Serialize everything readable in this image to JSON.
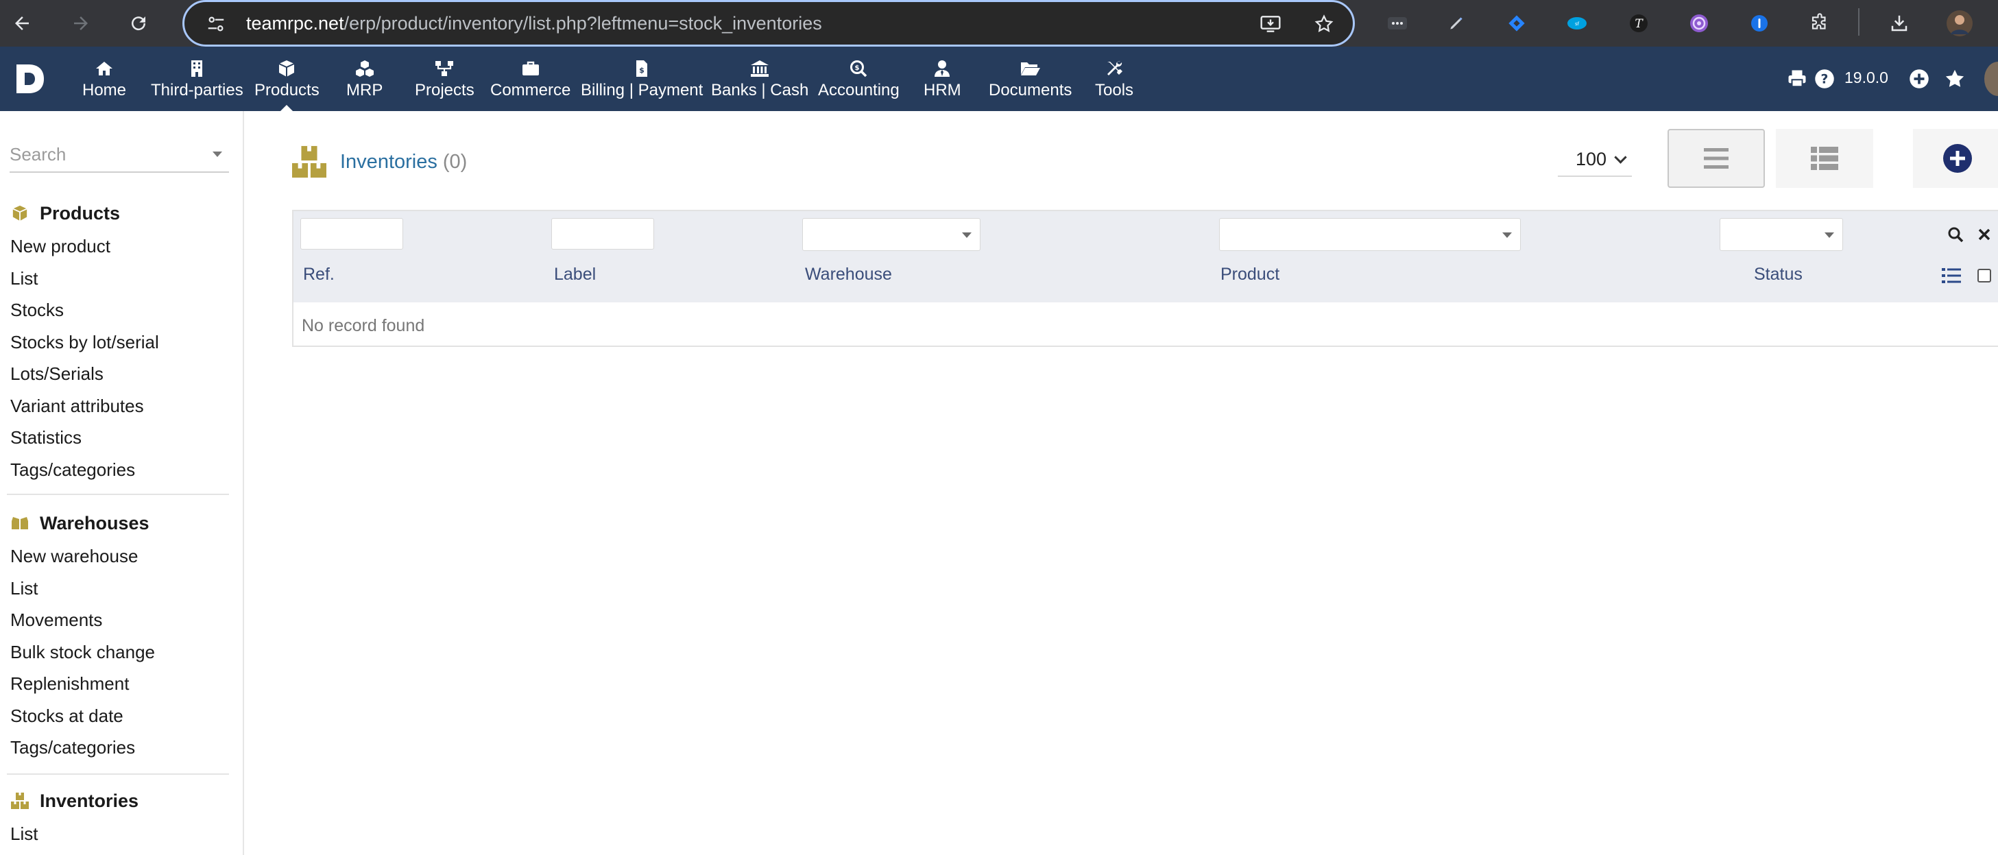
{
  "browser": {
    "url_host": "teamrpc.net",
    "url_path": "/erp/product/inventory/list.php?leftmenu=stock_inventories",
    "nav_icons": [
      "back-arrow-icon",
      "forward-arrow-icon",
      "reload-icon"
    ],
    "extension_icons": [
      "more-dots-icon",
      "pen-icon",
      "jira-icon",
      "salesforce-icon",
      "t-extension-icon",
      "target-extension-icon",
      "password-extension-icon",
      "puzzle-icon",
      "download-icon"
    ]
  },
  "topbar": {
    "menu": [
      {
        "label": "Home",
        "icon": "home-icon"
      },
      {
        "label": "Third-parties",
        "icon": "building-icon"
      },
      {
        "label": "Products",
        "icon": "cube-icon",
        "active": true
      },
      {
        "label": "MRP",
        "icon": "cubes-icon"
      },
      {
        "label": "Projects",
        "icon": "sitemap-icon"
      },
      {
        "label": "Commerce",
        "icon": "briefcase-icon"
      },
      {
        "label": "Billing | Payment",
        "icon": "invoice-icon"
      },
      {
        "label": "Banks | Cash",
        "icon": "bank-icon"
      },
      {
        "label": "Accounting",
        "icon": "search-dollar-icon"
      },
      {
        "label": "HRM",
        "icon": "user-tie-icon"
      },
      {
        "label": "Documents",
        "icon": "folder-open-icon"
      },
      {
        "label": "Tools",
        "icon": "tools-icon"
      }
    ],
    "version": "19.0.0",
    "right_icons": [
      "print-icon",
      "help-icon",
      "plus-circle-icon",
      "star-icon"
    ]
  },
  "sidebar": {
    "search_placeholder": "Search",
    "sections": [
      {
        "title": "Products",
        "icon": "cube-icon",
        "links": [
          "New product",
          "List",
          "Stocks",
          "Stocks by lot/serial",
          "Lots/Serials",
          "Variant attributes",
          "Statistics",
          "Tags/categories"
        ]
      },
      {
        "title": "Warehouses",
        "icon": "boxes-icon",
        "links": [
          "New warehouse",
          "List",
          "Movements",
          "Bulk stock change",
          "Replenishment",
          "Stocks at date",
          "Tags/categories"
        ]
      },
      {
        "title": "Inventories",
        "icon": "boxes-stacked-icon",
        "links": [
          "List"
        ]
      }
    ]
  },
  "main": {
    "title": "Inventories",
    "count": "(0)",
    "limit": "100",
    "columns": [
      "Ref.",
      "Label",
      "Warehouse",
      "Product",
      "Status"
    ],
    "empty_message": "No record found"
  },
  "colors": {
    "topbar": "#263c5c",
    "accent_gold": "#b5a040",
    "title_blue": "#2a6fa0",
    "column_blue": "#3a4d7a",
    "new_button": "#1f2f6e"
  }
}
